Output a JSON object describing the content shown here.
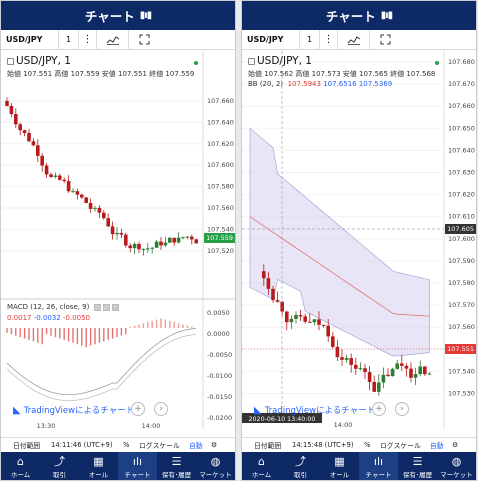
{
  "header": {
    "title": "チャート",
    "icon": "chart-bars-icon"
  },
  "colors": {
    "navy": "#0d2a66",
    "up": "#2e7d32",
    "down": "#b71c1c",
    "price_tag_green": "#26a148",
    "price_tag_red": "#e53935",
    "bb_fill": "#d8d6f0",
    "bb_line": "#9b98d6",
    "tv_blue": "#2962ff"
  },
  "left": {
    "toolbar": {
      "symbol": "USD/JPY",
      "interval": "1"
    },
    "legend": {
      "title": "USD/JPY, 1",
      "ohlc": "始値 107.551 高値 107.559 安値 107.551 終値 107.559"
    },
    "macd": {
      "label": "MACD (12, 26, close, 9)",
      "v1": "0.0017",
      "v2": "-0.0032",
      "v3": "-0.0050"
    },
    "price_tag": "107.559",
    "price_axis": [
      "107.660",
      "107.640",
      "107.620",
      "107.600",
      "107.580",
      "107.560",
      "107.540",
      "107.520"
    ],
    "macd_axis": [
      "0.0050",
      "0.0000",
      "-0.0050",
      "-0.0100",
      "-0.0150",
      "-0.0200"
    ],
    "time_axis": [
      "13:30",
      "14:00"
    ],
    "bottom": {
      "range": "日付範囲",
      "clock": "14:11:46 (UTC+9)",
      "pct": "%",
      "log": "ログスケール",
      "auto": "自動"
    }
  },
  "right": {
    "toolbar": {
      "symbol": "USD/JPY",
      "interval": "1"
    },
    "legend": {
      "title": "USD/JPY, 1",
      "ohlc": "始値 107.562 高値 107.573 安値 107.565 終値 107.568",
      "bb_label": "BB (20, 2)",
      "bb_v1": "107.5943",
      "bb_v2": "107.6516",
      "bb_v3": "107.5369"
    },
    "price_tag": "107.551",
    "price_tag2": "107.605",
    "price_axis": [
      "107.680",
      "107.670",
      "107.660",
      "107.650",
      "107.640",
      "107.630",
      "107.620",
      "107.610",
      "107.600",
      "107.590",
      "107.580",
      "107.570",
      "107.560",
      "107.550",
      "107.540",
      "107.530"
    ],
    "time_axis": [
      "2020-06-10 13:40:00",
      "14:00"
    ],
    "bottom": {
      "range": "日付範囲",
      "clock": "14:15:48 (UTC+9)",
      "pct": "%",
      "log": "ログスケール",
      "auto": "自動"
    }
  },
  "tradingview": "TradingViewによるチャート",
  "tabs": [
    {
      "label": "ホーム",
      "icon": "home-icon"
    },
    {
      "label": "取引",
      "icon": "trade-chart-icon"
    },
    {
      "label": "オール",
      "icon": "all-grid-icon"
    },
    {
      "label": "チャート",
      "icon": "candle-chart-icon"
    },
    {
      "label": "保有･履歴",
      "icon": "list-icon"
    },
    {
      "label": "マーケット",
      "icon": "globe-icon"
    }
  ]
}
